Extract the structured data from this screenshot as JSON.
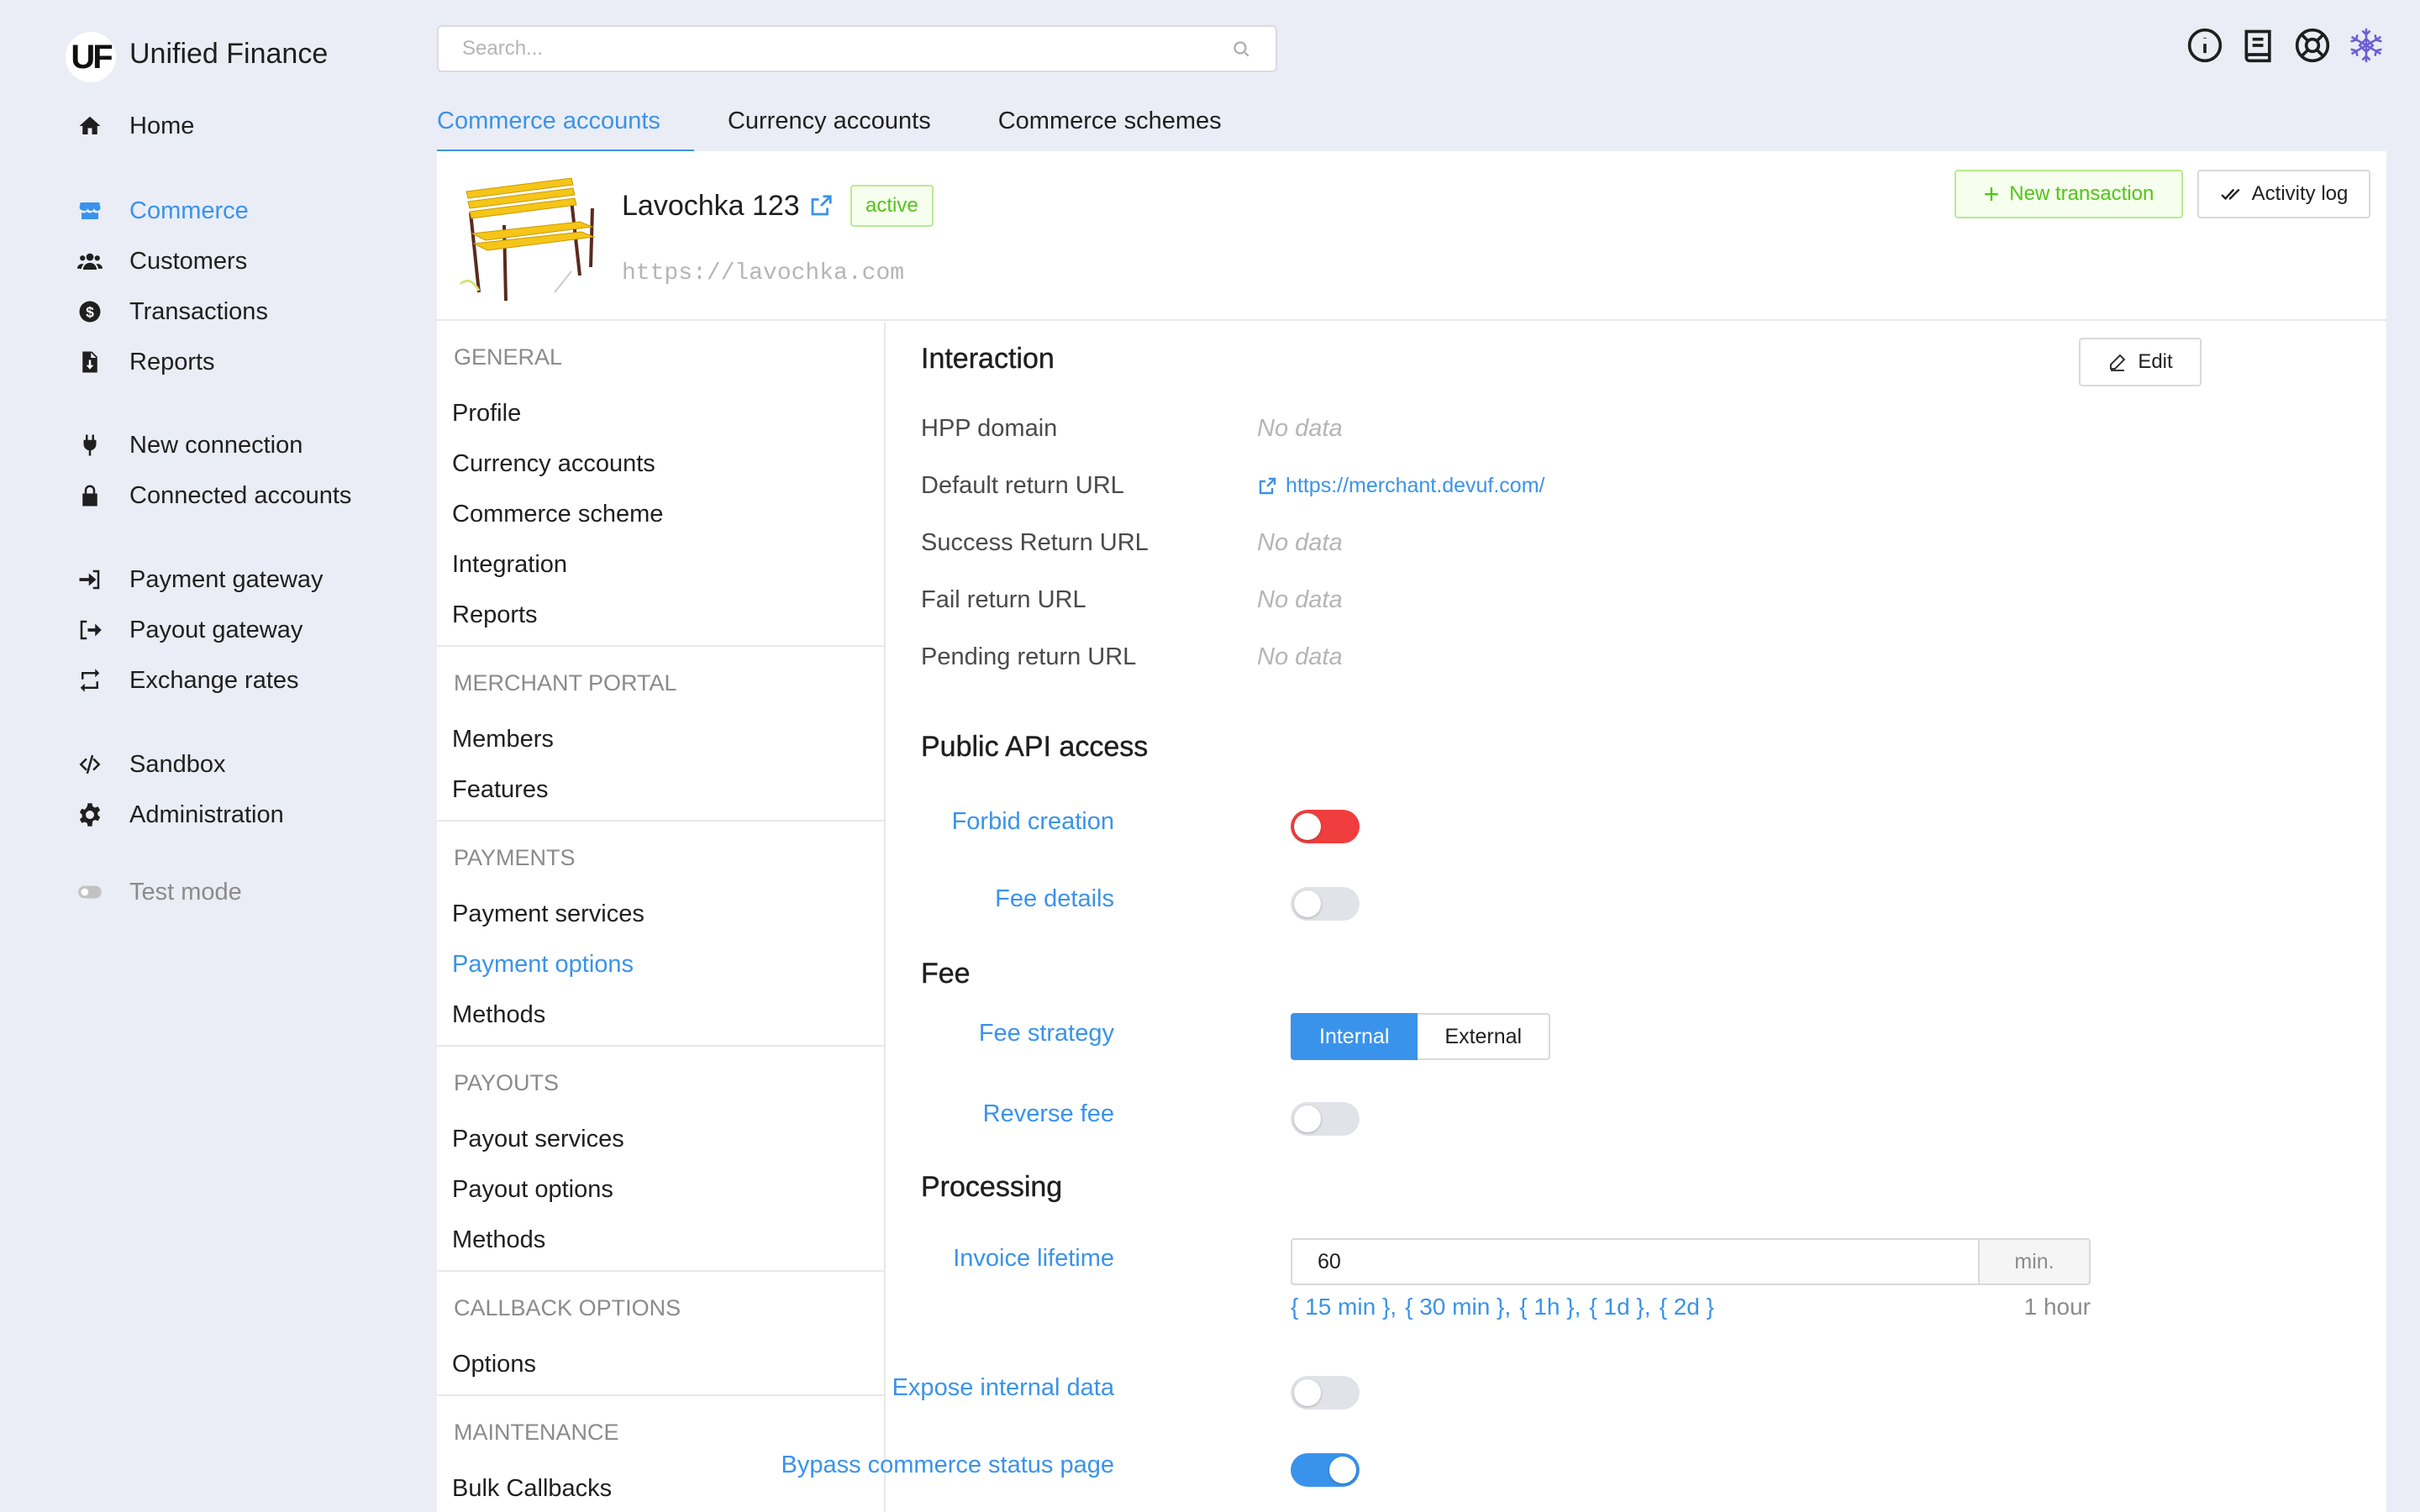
{
  "app": {
    "logo_mark": "UF",
    "name": "Unified Finance"
  },
  "sidebar": {
    "items": [
      {
        "label": "Home",
        "icon": "home-icon"
      },
      {
        "label": "Commerce",
        "icon": "store-icon",
        "active": true
      },
      {
        "label": "Customers",
        "icon": "users-icon"
      },
      {
        "label": "Transactions",
        "icon": "dollar-circle-icon"
      },
      {
        "label": "Reports",
        "icon": "file-download-icon"
      },
      {
        "label": "New connection",
        "icon": "plug-icon"
      },
      {
        "label": "Connected accounts",
        "icon": "lock-icon"
      },
      {
        "label": "Payment gateway",
        "icon": "sign-in-icon"
      },
      {
        "label": "Payout gateway",
        "icon": "sign-out-icon"
      },
      {
        "label": "Exchange rates",
        "icon": "exchange-icon"
      },
      {
        "label": "Sandbox",
        "icon": "code-icon"
      },
      {
        "label": "Administration",
        "icon": "gear-icon"
      },
      {
        "label": "Test mode",
        "icon": "toggle-icon"
      }
    ]
  },
  "search": {
    "placeholder": "Search..."
  },
  "top_icons": [
    "info-icon",
    "book-icon",
    "lifebuoy-icon",
    "avatar-snowflake-icon"
  ],
  "tabs": [
    {
      "label": "Commerce accounts",
      "active": true
    },
    {
      "label": "Currency accounts"
    },
    {
      "label": "Commerce schemes"
    }
  ],
  "account": {
    "name": "Lavochka 123",
    "status": "active",
    "url": "https://lavochka.com",
    "new_transaction_label": "New transaction",
    "activity_log_label": "Activity log"
  },
  "submenu": {
    "groups": [
      {
        "title": "GENERAL",
        "items": [
          "Profile",
          "Currency accounts",
          "Commerce scheme",
          "Integration",
          "Reports"
        ]
      },
      {
        "title": "MERCHANT PORTAL",
        "items": [
          "Members",
          "Features"
        ]
      },
      {
        "title": "PAYMENTS",
        "items": [
          "Payment services",
          "Payment options",
          "Methods"
        ],
        "active_item": "Payment options"
      },
      {
        "title": "PAYOUTS",
        "items": [
          "Payout services",
          "Payout options",
          "Methods"
        ]
      },
      {
        "title": "CALLBACK OPTIONS",
        "items": [
          "Options"
        ]
      },
      {
        "title": "MAINTENANCE",
        "items": [
          "Bulk Callbacks"
        ]
      }
    ]
  },
  "content": {
    "edit_label": "Edit",
    "interaction": {
      "title": "Interaction",
      "rows": [
        {
          "label": "HPP domain",
          "value": "No data"
        },
        {
          "label": "Default return URL",
          "link": "https://merchant.devuf.com/"
        },
        {
          "label": "Success Return URL",
          "value": "No data"
        },
        {
          "label": "Fail return URL",
          "value": "No data"
        },
        {
          "label": "Pending return URL",
          "value": "No data"
        }
      ]
    },
    "public_api": {
      "title": "Public API access",
      "forbid_creation_label": "Forbid creation",
      "forbid_creation_on": true,
      "fee_details_label": "Fee details",
      "fee_details_on": false
    },
    "fee": {
      "title": "Fee",
      "fee_strategy_label": "Fee strategy",
      "options": [
        "Internal",
        "External"
      ],
      "selected": "Internal",
      "reverse_fee_label": "Reverse fee",
      "reverse_fee_on": false
    },
    "processing": {
      "title": "Processing",
      "invoice_lifetime_label": "Invoice lifetime",
      "invoice_lifetime_value": "60",
      "invoice_lifetime_unit": "min.",
      "presets": [
        "{ 15 min },",
        "{ 30 min },",
        "{ 1h },",
        "{ 1d },",
        "{ 2d }"
      ],
      "hint": "1 hour",
      "expose_internal_label": "Expose internal data",
      "expose_internal_on": false,
      "bypass_status_label": "Bypass commerce status page",
      "bypass_status_on": true
    }
  },
  "colors": {
    "accent": "#3a93ea",
    "danger": "#f03e3e",
    "success": "#52c41a",
    "background": "#eaedf5"
  }
}
